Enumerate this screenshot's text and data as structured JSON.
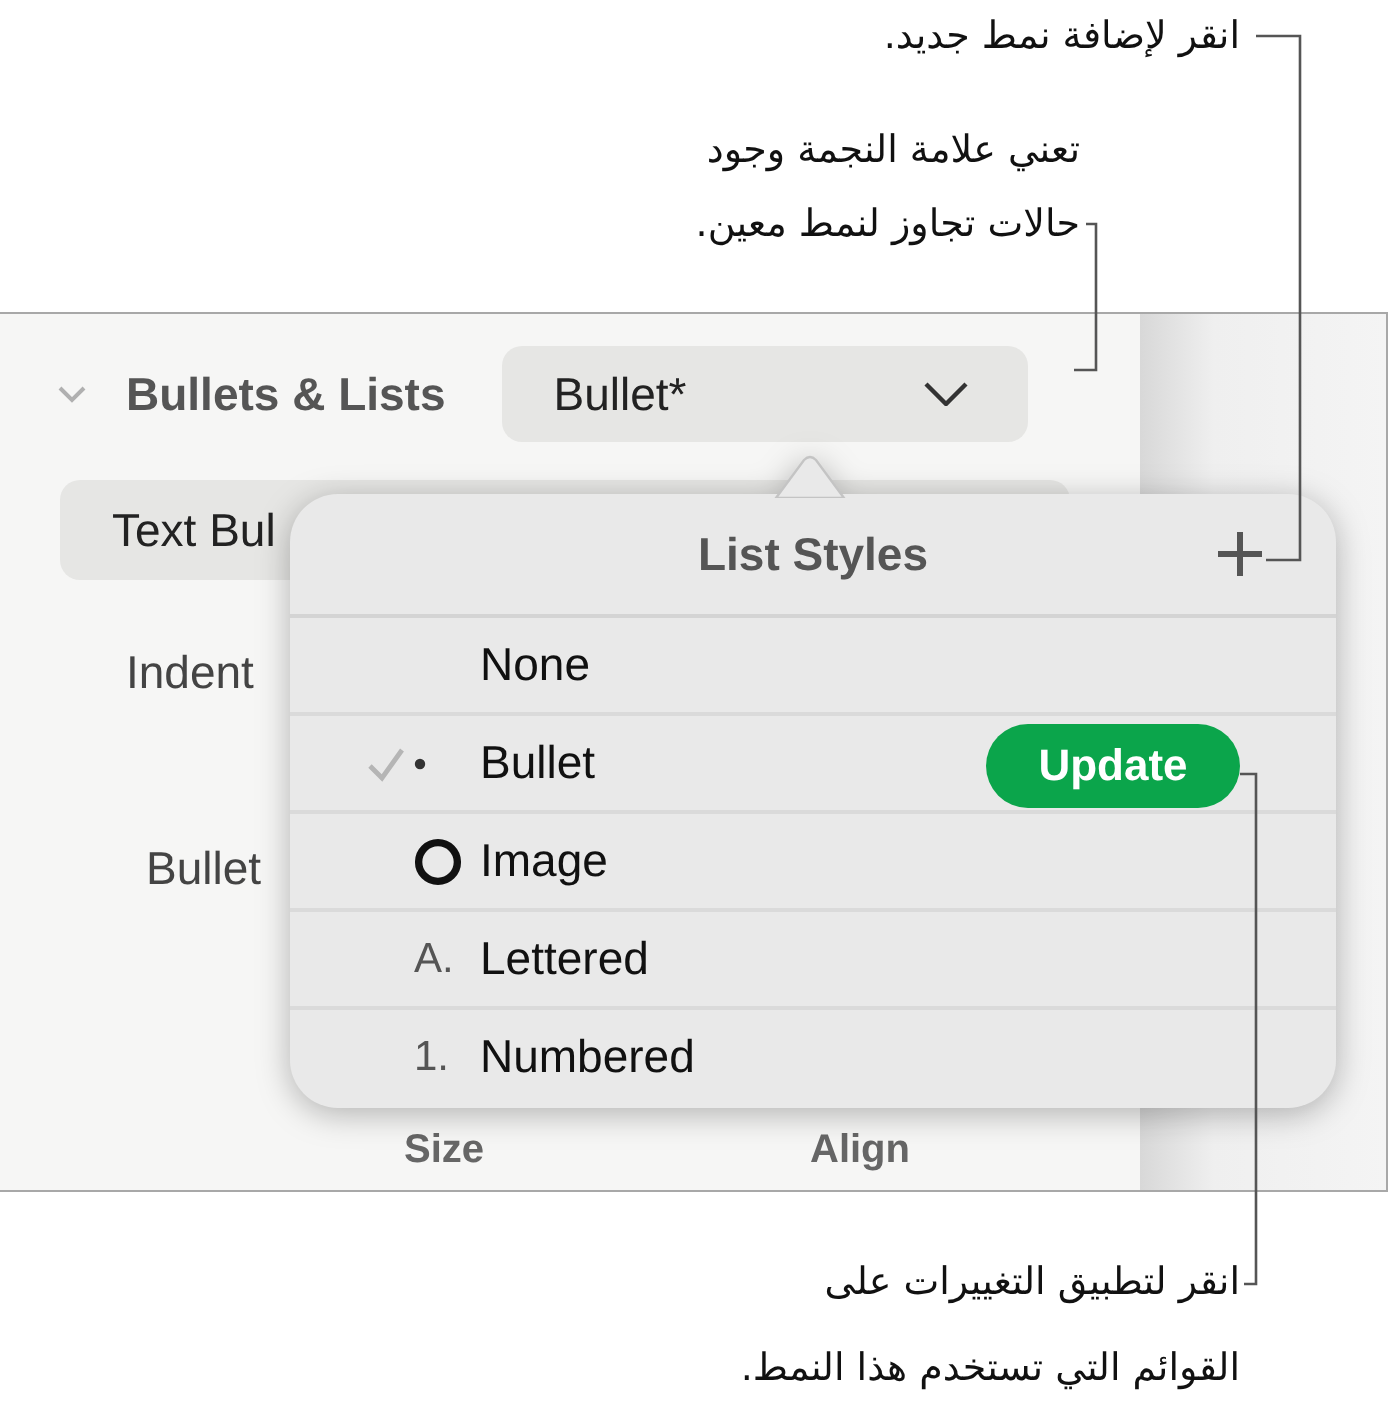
{
  "callouts": [
    {
      "text": "انقر لإضافة نمط جديد."
    },
    {
      "text": "تعني علامة النجمة وجود\nحالات تجاوز لنمط معين."
    },
    {
      "text": "انقر لتطبيق التغييرات على\nالقوائم التي تستخدم هذا النمط."
    }
  ],
  "inspector": {
    "section": {
      "title": "Bullets & Lists",
      "expanded": true
    },
    "style_popup": {
      "value": "Bullet*"
    },
    "bullet_type_popup": {
      "value": "Text Bul"
    },
    "indent_label": "Indent",
    "bullet_label": "Bullet",
    "size_label": "Size",
    "align_label": "Align"
  },
  "popover": {
    "title": "List Styles",
    "items": [
      {
        "kind": "none",
        "label": "None",
        "selected": false
      },
      {
        "kind": "dot",
        "label": "Bullet",
        "selected": true,
        "action": "Update"
      },
      {
        "kind": "ring",
        "label": "Image",
        "selected": false
      },
      {
        "kind": "text",
        "marker": "A.",
        "label": "Lettered",
        "selected": false
      },
      {
        "kind": "text",
        "marker": "1.",
        "label": "Numbered",
        "selected": false
      }
    ]
  }
}
